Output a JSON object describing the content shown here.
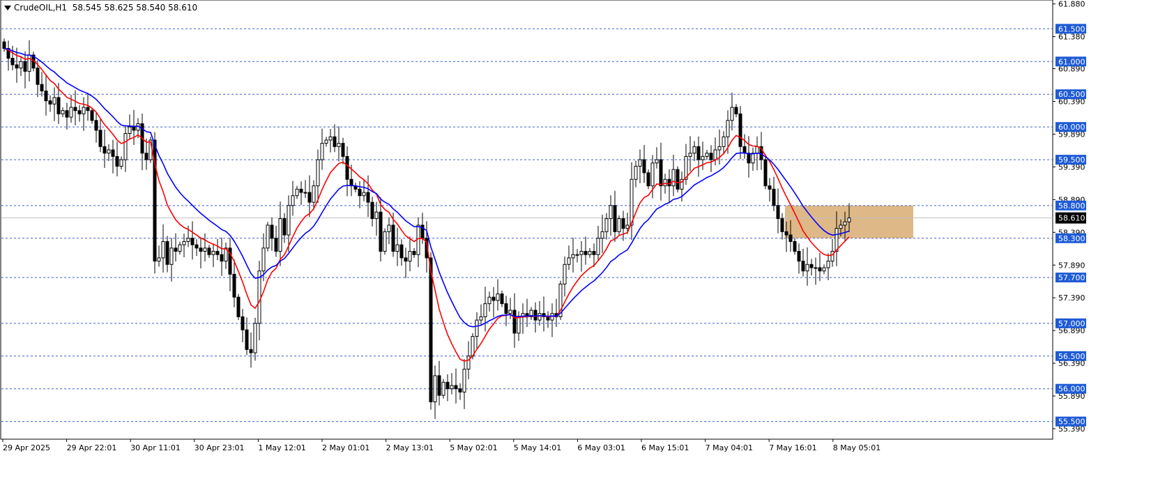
{
  "header": {
    "symbol": "CrudeOIL,H1",
    "ohlc": "58.545 58.625 58.540 58.610"
  },
  "colors": {
    "bull_candle": "#ffffff",
    "bear_candle": "#000000",
    "ema_fast": "#ff0000",
    "ema_slow": "#0000ff",
    "level_line": "#3a5fcd",
    "level_label_bg": "#1e5bd6",
    "zone_fill": "#deb887",
    "price_label_bg": "#000000"
  },
  "chart_data": {
    "type": "candlestick",
    "ylim": [
      55.23,
      61.94
    ],
    "axis_ticks": [
      "61.880",
      "61.380",
      "60.890",
      "60.390",
      "59.890",
      "59.390",
      "58.890",
      "58.390",
      "57.890",
      "57.390",
      "56.890",
      "56.390",
      "55.890",
      "55.390"
    ],
    "levels": [
      61.5,
      61.0,
      60.5,
      60.0,
      59.5,
      58.8,
      58.3,
      57.7,
      57.0,
      56.5,
      56.0,
      55.5
    ],
    "level_labels": [
      "61.500",
      "61.000",
      "60.500",
      "60.000",
      "59.500",
      "58.800",
      "58.300",
      "57.700",
      "57.000",
      "56.500",
      "56.000",
      "55.500"
    ],
    "current_price": 58.61,
    "current_price_label": "58.610",
    "x_labels": [
      "29 Apr 2025",
      "29 Apr 22:01",
      "30 Apr 11:01",
      "30 Apr 23:01",
      "1 May 12:01",
      "2 May 01:01",
      "2 May 13:01",
      "5 May 02:01",
      "5 May 14:01",
      "6 May 03:01",
      "6 May 15:01",
      "7 May 04:01",
      "7 May 16:01",
      "8 May 05:01"
    ],
    "candles_close": [
      61.2,
      61.05,
      60.95,
      60.9,
      61.0,
      60.85,
      61.1,
      60.9,
      60.65,
      60.55,
      60.4,
      60.35,
      60.45,
      60.2,
      60.25,
      60.15,
      60.3,
      60.25,
      60.2,
      60.3,
      60.25,
      60.1,
      59.95,
      59.7,
      59.6,
      59.65,
      59.55,
      59.4,
      59.5,
      59.9,
      60.0,
      59.95,
      60.05,
      59.6,
      59.5,
      59.8,
      57.95,
      58.0,
      58.25,
      57.9,
      58.15,
      58.1,
      58.2,
      58.25,
      58.3,
      58.2,
      58.15,
      58.1,
      58.15,
      58.05,
      58.1,
      58.05,
      57.95,
      58.15,
      57.75,
      57.4,
      57.1,
      56.9,
      56.6,
      56.55,
      57.0,
      57.8,
      58.15,
      58.5,
      58.3,
      58.1,
      58.6,
      58.35,
      58.8,
      58.95,
      59.05,
      59.0,
      59.0,
      58.85,
      59.1,
      59.5,
      59.75,
      59.8,
      59.85,
      59.7,
      59.75,
      59.55,
      59.2,
      59.1,
      59.05,
      58.95,
      59.0,
      58.85,
      58.6,
      58.7,
      58.1,
      58.4,
      58.5,
      58.1,
      58.2,
      58.0,
      57.95,
      58.1,
      58.05,
      58.5,
      58.3,
      58.0,
      55.8,
      56.2,
      55.9,
      56.1,
      56.0,
      56.05,
      56.0,
      55.95,
      56.3,
      56.5,
      56.8,
      57.05,
      57.1,
      57.3,
      57.4,
      57.35,
      57.45,
      57.3,
      57.15,
      57.2,
      56.85,
      57.1,
      57.15,
      57.1,
      57.2,
      57.05,
      57.15,
      57.1,
      57.05,
      57.15,
      57.1,
      57.6,
      57.9,
      58.0,
      58.05,
      58.05,
      58.1,
      58.05,
      58.1,
      58.05,
      58.3,
      58.4,
      58.6,
      58.8,
      58.4,
      58.6,
      58.45,
      58.5,
      59.2,
      59.4,
      59.5,
      59.3,
      59.1,
      59.45,
      59.5,
      59.1,
      59.2,
      59.1,
      59.35,
      59.05,
      59.2,
      59.55,
      59.6,
      59.7,
      59.5,
      59.55,
      59.6,
      59.5,
      59.65,
      59.7,
      59.85,
      60.1,
      60.3,
      60.2,
      59.7,
      59.6,
      59.45,
      59.6,
      59.7,
      59.5,
      59.1,
      59.05,
      58.8,
      58.6,
      58.4,
      58.35,
      58.25,
      58.1,
      57.95,
      57.8,
      57.9,
      57.85,
      57.85,
      57.8,
      57.85,
      57.95,
      58.1,
      58.45,
      58.5,
      58.55,
      58.61
    ]
  }
}
